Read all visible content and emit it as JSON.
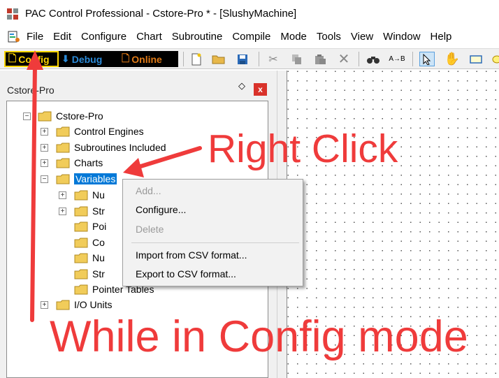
{
  "window": {
    "title": "PAC Control Professional - Cstore-Pro * - [SlushyMachine]"
  },
  "menu": {
    "items": [
      "File",
      "Edit",
      "Configure",
      "Chart",
      "Subroutine",
      "Compile",
      "Mode",
      "Tools",
      "View",
      "Window",
      "Help"
    ]
  },
  "toolbar": {
    "modes": {
      "config": "Config",
      "debug": "Debug",
      "online": "Online"
    },
    "icons": [
      "new-file-icon",
      "open-folder-icon",
      "save-icon",
      "cut-icon",
      "copy-icon",
      "paste-icon",
      "delete-icon",
      "find-icon",
      "replace-icon",
      "select-pointer-icon",
      "hand-icon",
      "rectangle-icon",
      "ellipse-icon"
    ]
  },
  "panel": {
    "title": "Cstore-Pro",
    "close_glyph": "x"
  },
  "tree": {
    "root": "Cstore-Pro",
    "items": {
      "control_engines": "Control Engines",
      "subroutines": "Subroutines Included",
      "charts": "Charts",
      "variables": "Variables",
      "child_nu1": "Nu",
      "child_str1": "Str",
      "child_poi": "Poi",
      "child_co": "Co",
      "child_nu2": "Nu",
      "child_str2": "Str",
      "pointer_tables": "Pointer Tables",
      "io_units": "I/O Units"
    }
  },
  "context_menu": {
    "add": "Add...",
    "configure": "Configure...",
    "delete": "Delete",
    "import_csv": "Import from CSV format...",
    "export_csv": "Export to CSV format..."
  },
  "annotations": {
    "right_click": "Right Click",
    "while_config": "While in Config mode",
    "color": "#ef3b3b"
  },
  "colors": {
    "selection": "#0078d7",
    "config_mode": "#ffd400",
    "debug_mode": "#2a8ad8",
    "online_mode": "#e07a16",
    "close_button": "#d9322a"
  }
}
